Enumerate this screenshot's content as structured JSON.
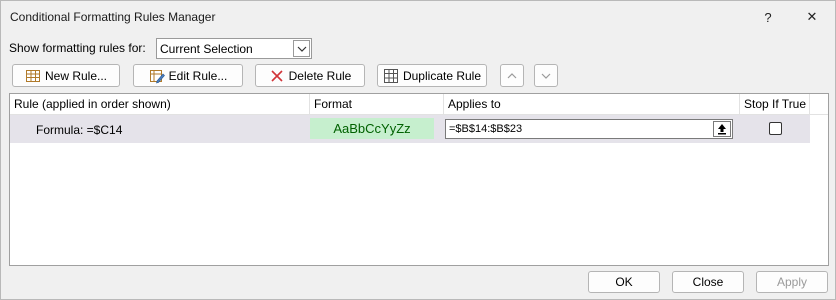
{
  "window": {
    "title": "Conditional Formatting Rules Manager",
    "help_label": "?",
    "close_label": "✕"
  },
  "show_rules": {
    "label": "Show formatting rules for:",
    "selected": "Current Selection"
  },
  "toolbar": {
    "new_rule": "New Rule...",
    "edit_rule": "Edit Rule...",
    "delete_rule": "Delete Rule",
    "duplicate_rule": "Duplicate Rule"
  },
  "table": {
    "columns": [
      "Rule (applied in order shown)",
      "Format",
      "Applies to",
      "Stop If True"
    ],
    "rows": [
      {
        "rule": "Formula: =$C14",
        "format_sample": "AaBbCcYyZz",
        "applies_to": "=$B$14:$B$23",
        "stop_if_true": false
      }
    ]
  },
  "footer": {
    "ok": "OK",
    "close": "Close",
    "apply": "Apply"
  },
  "colors": {
    "format_fill": "#c6efce",
    "format_text": "#006100",
    "selected_row": "#e5e3ea",
    "delete_icon": "#d13438"
  }
}
